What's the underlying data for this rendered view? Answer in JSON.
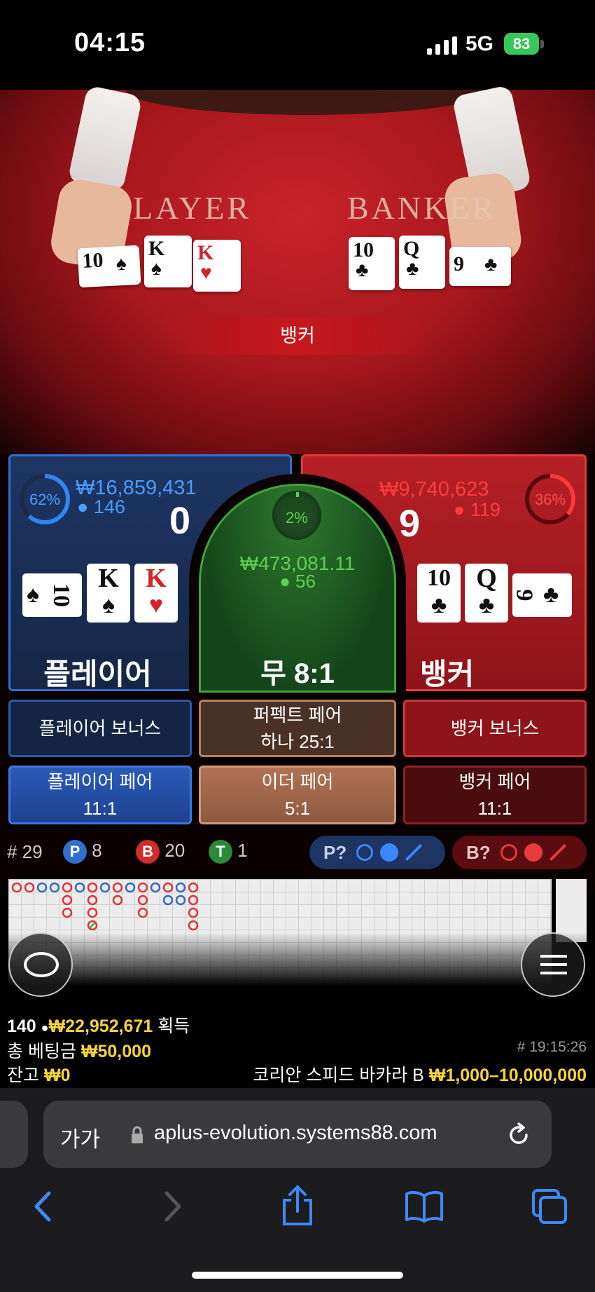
{
  "status_bar": {
    "time": "04:15",
    "network": "5G",
    "battery": "83"
  },
  "video": {
    "felt_player": "LAYER",
    "felt_banker": "BANKER",
    "result_banner": "뱅커"
  },
  "player": {
    "percent": "62%",
    "amount": "₩16,859,431",
    "players": "146",
    "score": "0",
    "cards": [
      {
        "rank": "10",
        "suit": "♠"
      },
      {
        "rank": "K",
        "suit": "♠"
      },
      {
        "rank": "K",
        "suit": "♥"
      }
    ],
    "label": "플레이어"
  },
  "tie": {
    "percent": "2%",
    "amount": "₩473,081.11",
    "players": "56",
    "label": "무 8:1"
  },
  "banker": {
    "percent": "36%",
    "amount": "₩9,740,623",
    "players": "119",
    "score": "9",
    "cards": [
      {
        "rank": "10",
        "suit": "♣"
      },
      {
        "rank": "Q",
        "suit": "♣"
      },
      {
        "rank": "9",
        "suit": "♣"
      }
    ],
    "label": "뱅커"
  },
  "side_bets": {
    "player_bonus": "플레이어 보너스",
    "perfect_pair_1": "퍼펙트 페어",
    "perfect_pair_2": "하나 25:1",
    "banker_bonus": "뱅커 보너스",
    "player_pair_1": "플레이어 페어",
    "player_pair_2": "11:1",
    "either_pair_1": "이더 페어",
    "either_pair_2": "5:1",
    "banker_pair_1": "뱅커 페어",
    "banker_pair_2": "11:1"
  },
  "stats": {
    "rounds": "# 29",
    "p_letter": "P",
    "p_count": "8",
    "b_letter": "B",
    "b_count": "20",
    "t_letter": "T",
    "t_count": "1",
    "p_predict": "P?",
    "b_predict": "B?"
  },
  "info": {
    "winners": "140",
    "won_amount": "₩22,952,671",
    "won_label": "획득",
    "total_bet_label": "총 베팅금",
    "total_bet": "₩50,000",
    "round_id": "# 19:15:26",
    "balance_label": "잔고",
    "balance": "₩0",
    "table_name": "코리안 스피드 바카라 B",
    "limits": "₩1,000–10,000,000"
  },
  "browser": {
    "text_size": "가가",
    "url": "aplus-evolution.systems88.com"
  },
  "colors": {
    "player_blue": "#2f6fd0",
    "banker_red": "#e03a3a",
    "tie_green": "#3fa53a",
    "gold": "#f6d33a",
    "ios_blue": "#3d8af7"
  }
}
